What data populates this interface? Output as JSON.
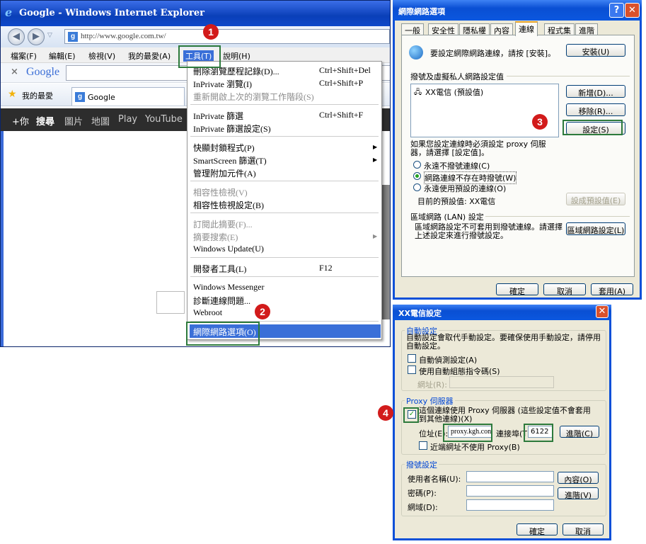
{
  "ie": {
    "title": "Google - Windows Internet Explorer",
    "address": "http://www.google.com.tw/",
    "menu": [
      "檔案(F)",
      "編輯(E)",
      "檢視(V)",
      "我的最愛(A)",
      "工具(T)",
      "說明(H)"
    ],
    "google_search_logo": "Google",
    "favorites_label": "我的最愛",
    "tab_title": "Google",
    "google_bar": [
      "+你",
      "搜尋",
      "圖片",
      "地圖",
      "Play",
      "YouTube"
    ]
  },
  "tools_menu": {
    "items": [
      {
        "label": "刪除瀏覽歷程記錄(D)...",
        "shortcut": "Ctrl+Shift+Del",
        "disabled": false
      },
      {
        "label": "InPrivate 瀏覽(I)",
        "shortcut": "Ctrl+Shift+P",
        "disabled": false
      },
      {
        "label": "重新開啟上次的瀏覽工作階段(S)",
        "shortcut": "",
        "disabled": true
      },
      {
        "label": "InPrivate 篩選",
        "shortcut": "Ctrl+Shift+F",
        "disabled": false
      },
      {
        "label": "InPrivate 篩選設定(S)",
        "shortcut": "",
        "disabled": false
      },
      {
        "label": "快顯封鎖程式(P)",
        "shortcut": "",
        "disabled": false,
        "submenu": true
      },
      {
        "label": "SmartScreen 篩選(T)",
        "shortcut": "",
        "disabled": false,
        "submenu": true
      },
      {
        "label": "管理附加元件(A)",
        "shortcut": "",
        "disabled": false
      },
      {
        "label": "相容性檢視(V)",
        "shortcut": "",
        "disabled": true
      },
      {
        "label": "相容性檢視設定(B)",
        "shortcut": "",
        "disabled": false
      },
      {
        "label": "訂閱此摘要(F)...",
        "shortcut": "",
        "disabled": true
      },
      {
        "label": "摘要搜索(E)",
        "shortcut": "",
        "disabled": true,
        "submenu": true
      },
      {
        "label": "Windows Update(U)",
        "shortcut": "",
        "disabled": false
      },
      {
        "label": "開發者工具(L)",
        "shortcut": "F12",
        "disabled": false
      },
      {
        "label": "Windows Messenger",
        "shortcut": "",
        "disabled": false
      },
      {
        "label": "診斷連線問題...",
        "shortcut": "",
        "disabled": false
      },
      {
        "label": "Webroot",
        "shortcut": "",
        "disabled": false
      },
      {
        "label": "網際網路選項(O)",
        "shortcut": "",
        "disabled": false,
        "highlighted": true
      }
    ]
  },
  "markers": [
    "1",
    "2",
    "3",
    "4"
  ],
  "internet_options": {
    "title": "網際網路選項",
    "help_button": "?",
    "close_button": "✕",
    "tabs": [
      "一般",
      "安全性",
      "隱私權",
      "內容",
      "連線",
      "程式集",
      "進階"
    ],
    "active_tab": "連線",
    "setup_text": "要設定網際網路連線，請按 [安裝]。",
    "setup_button": "安裝(U)",
    "dialup_heading": "撥號及虛擬私人網路設定值",
    "connections": [
      "XX電信 (預設值)"
    ],
    "add_button": "新增(D)...",
    "remove_button": "移除(R)...",
    "settings_button": "設定(S)",
    "proxy_note": "如果您設定連線時必須設定 proxy 伺服器，請選擇 [設定值]。",
    "radio_options": [
      "永遠不撥號連線(C)",
      "網路連線不存在時撥號(W)",
      "永遠使用預設的連線(O)"
    ],
    "radio_selected": 1,
    "current_default": "目前的預設值:  XX電信",
    "set_default_button": "設成預設值(E)",
    "lan_heading": "區域網路 (LAN) 設定",
    "lan_text": "區域網路設定不可套用到撥號連線。請選擇上述設定來進行撥號設定。",
    "lan_button": "區域網路設定(L)",
    "ok_button": "確定",
    "cancel_button": "取消",
    "apply_button": "套用(A)"
  },
  "xx_settings": {
    "title": "XX電信設定",
    "close_button": "✕",
    "auto_group": "自動設定",
    "auto_text": "自動設定會取代手動設定。要確保使用手動設定，請停用自動設定。",
    "auto_detect": "自動偵測設定(A)",
    "auto_script": "使用自動組態指令碼(S)",
    "address_label": "網址(R):",
    "proxy_group": "Proxy 伺服器",
    "proxy_check_label": "這個連線使用 Proxy 伺服器 (這些設定值不會套用到其他連線)(X)",
    "proxy_checked": true,
    "addr_label": "位址(E):",
    "addr_value": "proxy.kgh.con",
    "port_label": "連接埠(T):",
    "port_value": "6122",
    "advanced_button": "進階(C)",
    "bypass_label": "近端網址不使用 Proxy(B)",
    "dialup_group": "撥號設定",
    "username_label": "使用者名稱(U):",
    "password_label": "密碼(P):",
    "domain_label": "網域(D):",
    "properties_button": "內容(O)",
    "advanced2_button": "進階(V)",
    "ok_button": "確定",
    "cancel_button": "取消"
  }
}
